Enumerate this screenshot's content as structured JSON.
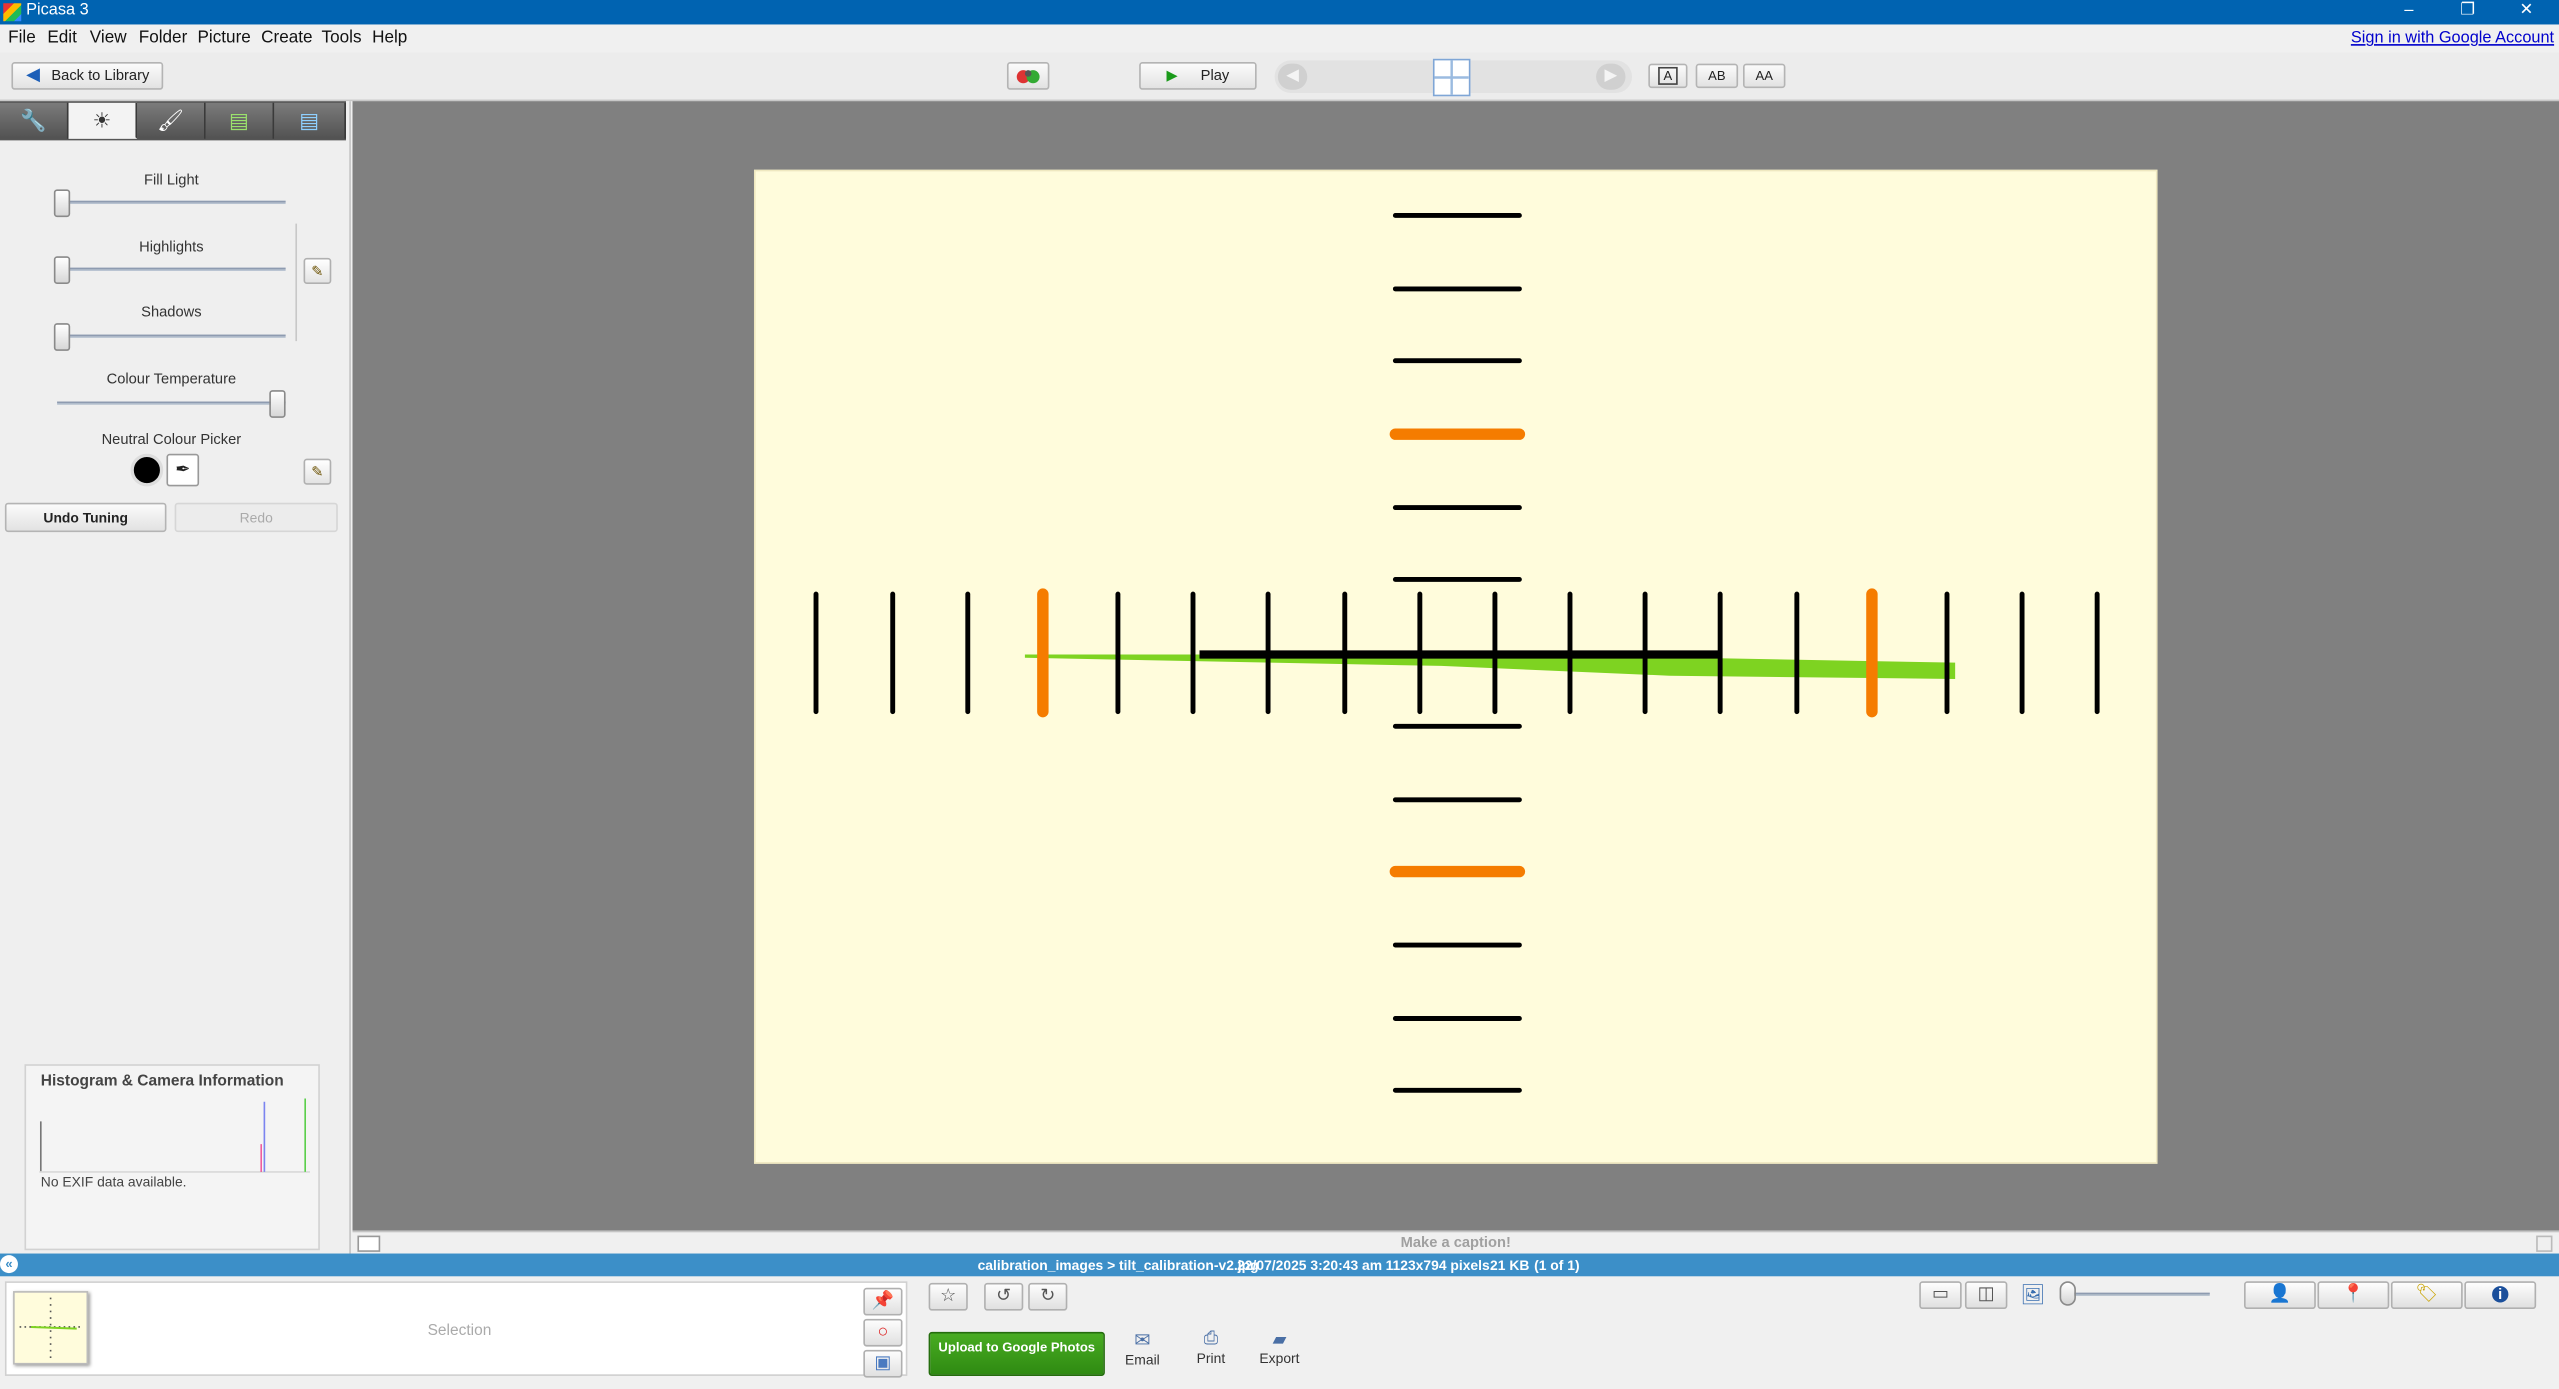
{
  "window": {
    "title": "Picasa 3",
    "minimize": "–",
    "restore": "❐",
    "close": "✕"
  },
  "menu": [
    "File",
    "Edit",
    "View",
    "Folder",
    "Picture",
    "Create",
    "Tools",
    "Help"
  ],
  "signin_link": "Sign in with Google Account",
  "toolbar": {
    "back_label": "Back to Library",
    "play_label": "Play",
    "caption_modes": [
      "A",
      "AB",
      "AA"
    ]
  },
  "tabs": [
    {
      "name": "basic-fixes",
      "icon": "wrench-icon",
      "glyph": "🔧"
    },
    {
      "name": "tuning",
      "icon": "sun-icon",
      "glyph": "☀"
    },
    {
      "name": "effects",
      "icon": "brush-icon",
      "glyph": "🖌"
    },
    {
      "name": "effects-2",
      "icon": "brush-image-icon",
      "glyph": "🖌"
    },
    {
      "name": "effects-3",
      "icon": "brush-image-icon",
      "glyph": "🖌"
    }
  ],
  "tuning": {
    "fill_light": {
      "label": "Fill Light",
      "value": 0.0
    },
    "highlights": {
      "label": "Highlights",
      "value": 0.0
    },
    "shadows": {
      "label": "Shadows",
      "value": 0.0
    },
    "colour_temperature": {
      "label": "Colour Temperature",
      "value": 1.0
    },
    "neutral_picker": {
      "label": "Neutral Colour Picker"
    },
    "undo_label": "Undo Tuning",
    "redo_label": "Redo"
  },
  "histogram": {
    "title": "Histogram & Camera Information",
    "exif_note": "No EXIF data available."
  },
  "caption_placeholder": "Make a caption!",
  "info": {
    "path": "calibration_images > tilt_calibration-v2.jpg",
    "datetime": "22/07/2025 3:20:43 am",
    "dimensions": "1123x794 pixels",
    "size": "21 KB",
    "position": "(1 of 1)"
  },
  "tray": {
    "selection_label": "Selection"
  },
  "actions": {
    "upload_label": "Upload to Google Photos",
    "email_label": "Email",
    "print_label": "Print",
    "export_label": "Export"
  },
  "colors": {
    "titlebar": "#0063b1",
    "infobar": "#3c8fc8",
    "photo_bg": "#fffcdc",
    "tick_black": "#000000",
    "tick_orange": "#f57c00",
    "green_line": "#7ed321",
    "upload_green": "#3a9a1a"
  }
}
